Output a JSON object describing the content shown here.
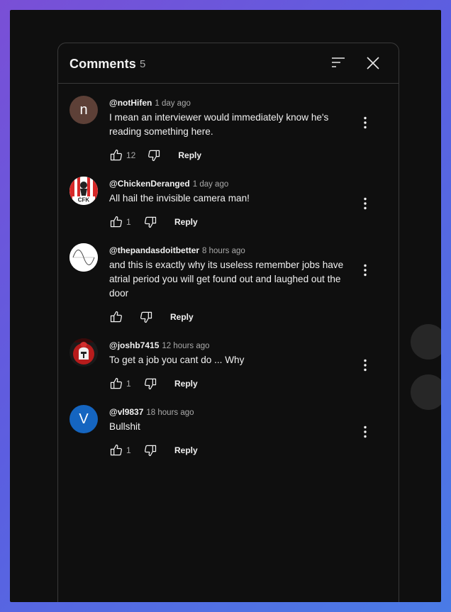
{
  "panel": {
    "title": "Comments",
    "count": "5",
    "sort_icon": "sort-icon",
    "close_icon": "close-icon"
  },
  "colors": {
    "background": "#0f0f0f",
    "text": "#f1f1f1",
    "secondary": "#aaaaaa",
    "avatar_n": "#5d4037",
    "avatar_v": "#1565c0"
  },
  "comments": [
    {
      "author": "@notHifen",
      "time": "1 day ago",
      "text": "I mean an interviewer would immediately know he's reading something here.",
      "likes": "12",
      "reply": "Reply",
      "avatar_letter": "n"
    },
    {
      "author": "@ChickenDeranged",
      "time": "1 day ago",
      "text": "All hail the invisible camera man!",
      "likes": "1",
      "reply": "Reply",
      "avatar_text": "CFK"
    },
    {
      "author": "@thepandasdoitbetter",
      "time": "8 hours ago",
      "text": "and this is exactly why its useless remember jobs have atrial period you will get found out and laughed out the door",
      "likes": "",
      "reply": "Reply"
    },
    {
      "author": "@joshb7415",
      "time": "12 hours ago",
      "text": "To get a job you cant do ... Why",
      "likes": "1",
      "reply": "Reply"
    },
    {
      "author": "@vl9837",
      "time": "18 hours ago",
      "text": "Bullshit",
      "likes": "1",
      "reply": "Reply",
      "avatar_letter": "V"
    }
  ]
}
